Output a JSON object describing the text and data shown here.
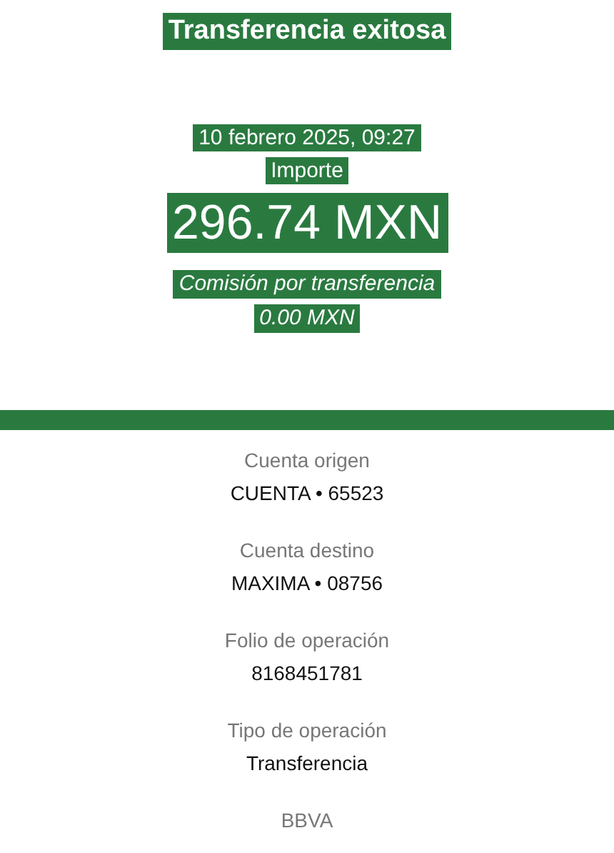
{
  "header": {
    "title": "Transferencia exitosa",
    "date": "10 febrero 2025, 09:27",
    "amount_label": "Importe",
    "amount": "296.74 MXN",
    "fee_label": "Comisión por transferencia",
    "fee": "0.00 MXN"
  },
  "details": [
    {
      "label": "Cuenta origen",
      "value": "CUENTA • 65523"
    },
    {
      "label": "Cuenta destino",
      "value": "MAXIMA • 08756"
    },
    {
      "label": "Folio de operación",
      "value": "8168451781"
    },
    {
      "label": "Tipo de operación",
      "value": "Transferencia"
    }
  ],
  "footer": "BBVA"
}
